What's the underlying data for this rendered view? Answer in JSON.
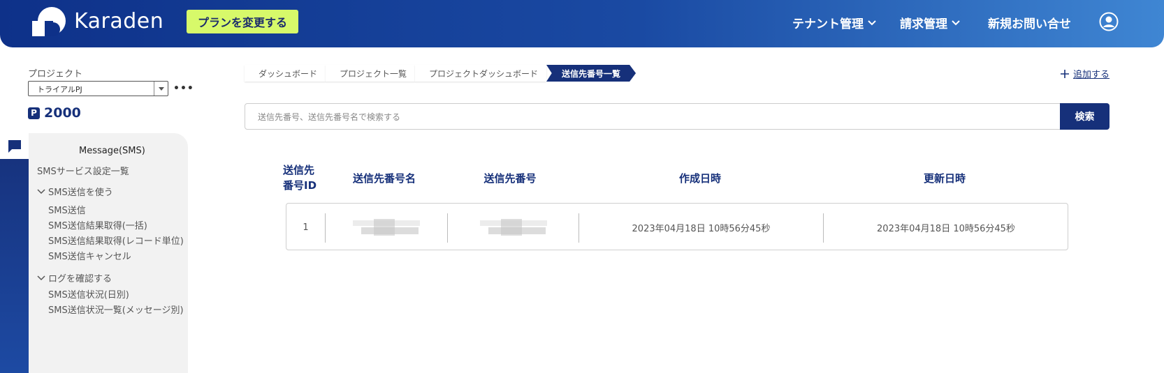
{
  "header": {
    "brand": "Karaden",
    "plan_button": "プランを変更する",
    "nav": [
      {
        "label": "テナント管理"
      },
      {
        "label": "請求管理"
      },
      {
        "label": "新規お問い合せ"
      }
    ],
    "colors": {
      "primary": "#16307a",
      "accent": "#d7f96a"
    }
  },
  "sidebar": {
    "project_label": "プロジェクト",
    "project_selected": "トライアルPJ",
    "points_badge": "P",
    "points_value": "2000",
    "menu_title": "Message(SMS)",
    "service_list": "SMSサービス設定一覧",
    "groups": [
      {
        "label": "SMS送信を使う",
        "items": [
          "SMS送信",
          "SMS送信結果取得(一括)",
          "SMS送信結果取得(レコード単位)",
          "SMS送信キャンセル"
        ]
      },
      {
        "label": "ログを確認する",
        "items": [
          "SMS送信状況(日別)",
          "SMS送信状況一覧(メッセージ別)"
        ]
      }
    ]
  },
  "breadcrumb": [
    "ダッシュボード",
    "プロジェクト一覧",
    "プロジェクトダッシュボード",
    "送信先番号一覧"
  ],
  "add_label": "追加する",
  "search": {
    "placeholder": "送信先番号、送信先番号名で検索する",
    "button": "検索"
  },
  "table": {
    "headers": [
      "送信先\n番号ID",
      "送信先番号名",
      "送信先番号",
      "作成日時",
      "更新日時"
    ],
    "rows": [
      {
        "id": "1",
        "created": "2023年04月18日 10時56分45秒",
        "updated": "2023年04月18日 10時56分45秒"
      }
    ]
  }
}
